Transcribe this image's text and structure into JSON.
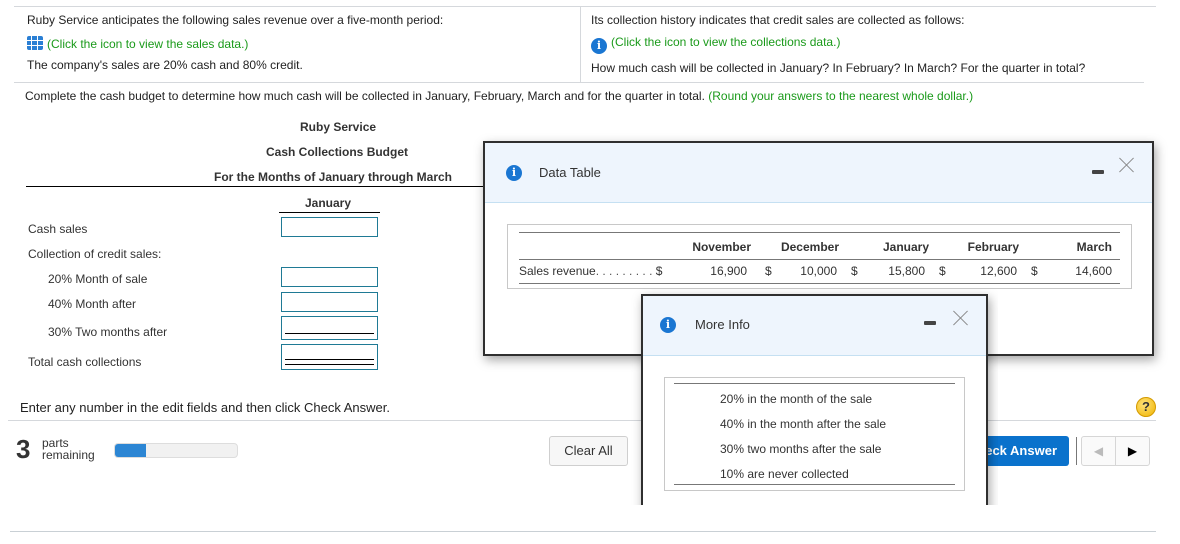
{
  "problem": {
    "left": {
      "intro": "Ruby Service anticipates the following sales revenue over a five-month period:",
      "link": "(Click the icon to view the sales data.)",
      "link_icon": "table-grid-icon",
      "note": "The company's sales are 20% cash and 80% credit."
    },
    "right": {
      "intro": "Its collection history indicates that credit sales are collected as follows:",
      "link": "(Click the icon to view the collections data.)",
      "link_icon": "info-icon",
      "question": "How much cash will be collected in January? In February? In March? For the quarter in total?"
    },
    "instruction": "Complete the cash budget to determine how much cash will be collected in January, February, March and for the quarter in total.",
    "instruction_hint": "(Round your answers to the nearest whole dollar.)"
  },
  "budget": {
    "company": "Ruby Service",
    "title": "Cash Collections Budget",
    "period": "For the Months of January through March",
    "column": "January",
    "rows": [
      {
        "label": "Cash sales",
        "value": ""
      },
      {
        "label": "Collection of credit sales:"
      },
      {
        "label": "20% Month of sale",
        "value": ""
      },
      {
        "label": "40% Month after",
        "value": ""
      },
      {
        "label": "30% Two months after",
        "value": ""
      },
      {
        "label": "Total cash collections",
        "value": ""
      }
    ]
  },
  "footer": {
    "hint": "Enter any number in the edit fields and then click Check Answer.",
    "parts_number": "3",
    "parts_label1": "parts",
    "parts_label2": "remaining",
    "progress_fraction": 0.25,
    "clear_all": "Clear All",
    "check_answer": "Check Answer",
    "help": "?",
    "prev": "◀",
    "next": "▶"
  },
  "data_table_dialog": {
    "title": "Data Table",
    "icon": "i",
    "headers": [
      "",
      "November",
      "December",
      "January",
      "February",
      "March"
    ],
    "row_label": "Sales revenue",
    "leader": ". . . . . . . . .",
    "currency": "$",
    "values": [
      "16,900",
      "10,000",
      "15,800",
      "12,600",
      "14,600"
    ]
  },
  "more_info_dialog": {
    "title": "More Info",
    "icon": "i",
    "lines": [
      "20% in the month of the sale",
      "40% in the month after the sale",
      "30% two months after the sale",
      "10% are never collected"
    ]
  }
}
